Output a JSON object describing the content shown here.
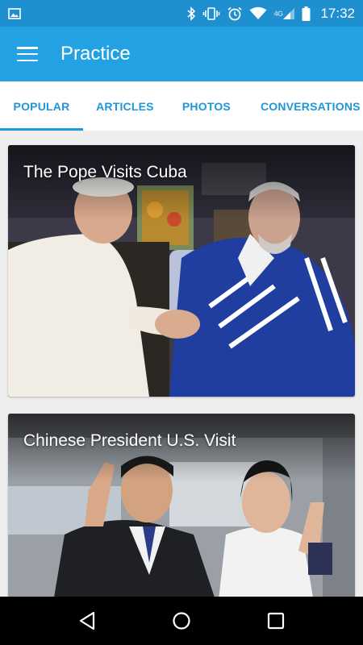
{
  "status_bar": {
    "time": "17:32",
    "network_label": "4G",
    "icons": [
      "image-notification-icon",
      "bluetooth-icon",
      "vibrate-icon",
      "alarm-icon",
      "wifi-icon",
      "signal-icon",
      "battery-icon"
    ]
  },
  "app_bar": {
    "title": "Practice",
    "menu_icon": "hamburger-menu-icon"
  },
  "tabs": [
    {
      "label": "POPULAR",
      "active": true
    },
    {
      "label": "ARTICLES",
      "active": false
    },
    {
      "label": "PHOTOS",
      "active": false
    },
    {
      "label": "CONVERSATIONS",
      "active": false
    }
  ],
  "feed": {
    "cards": [
      {
        "title": "The Pope Visits Cuba"
      },
      {
        "title": "Chinese President U.S. Visit"
      }
    ]
  },
  "nav_bar": {
    "icons": [
      "back-icon",
      "home-icon",
      "recents-icon"
    ]
  },
  "colors": {
    "status_bar": "#1e8fcf",
    "app_bar": "#23a2e3",
    "tab_accent": "#1e96d8",
    "background": "#eeeeee"
  }
}
